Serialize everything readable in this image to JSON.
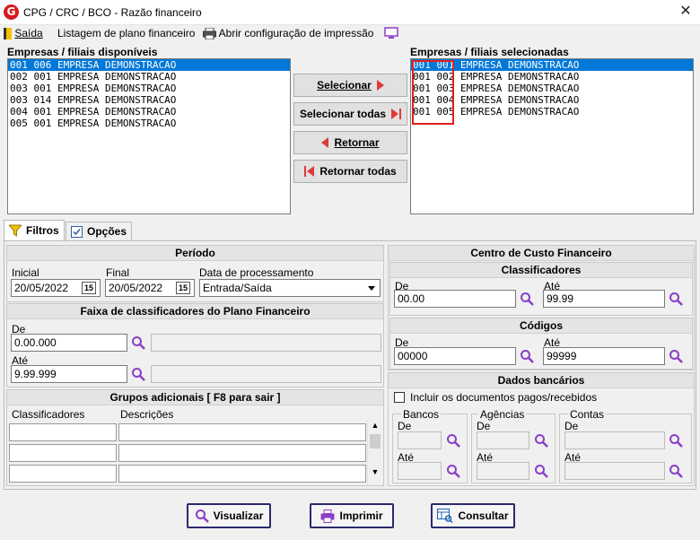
{
  "window": {
    "title": "CPG / CRC / BCO - Razão financeiro",
    "close_glyph": "✕"
  },
  "menu": {
    "exit_label": "Saída",
    "chart_list_label": "Listagem de plano financeiro",
    "print_config_label": "Abrir configuração de impressão"
  },
  "available": {
    "label": "Empresas / filiais disponíveis",
    "items": [
      "001 006 EMPRESA DEMONSTRACAO",
      "002 001 EMPRESA DEMONSTRACAO",
      "003 001 EMPRESA DEMONSTRACAO",
      "003 014 EMPRESA DEMONSTRACAO",
      "004 001 EMPRESA DEMONSTRACAO",
      "005 001 EMPRESA DEMONSTRACAO"
    ]
  },
  "selected": {
    "label": "Empresas / filiais selecionadas",
    "items": [
      "001 001 EMPRESA DEMONSTRACAO",
      "001 002 EMPRESA DEMONSTRACAO",
      "001 003 EMPRESA DEMONSTRACAO",
      "001 004 EMPRESA DEMONSTRACAO",
      "001 005 EMPRESA DEMONSTRACAO"
    ]
  },
  "transfer": {
    "select": "Selecionar",
    "select_all": "Selecionar todas",
    "return": "Retornar",
    "return_all": "Retornar todas"
  },
  "tabs": {
    "filters": "Filtros",
    "options": "Opções"
  },
  "periodo": {
    "title": "Período",
    "inicial_label": "Inicial",
    "inicial_value": "20/05/2022",
    "final_label": "Final",
    "final_value": "20/05/2022",
    "data_proc_label": "Data de processamento",
    "data_proc_value": "Entrada/Saída",
    "cal_glyph": "15"
  },
  "faixa": {
    "title": "Faixa de classificadores do Plano Financeiro",
    "de_label": "De",
    "de_value": "0.00.000",
    "ate_label": "Até",
    "ate_value": "9.99.999"
  },
  "grupos": {
    "title": "Grupos adicionais [ F8 para sair ]",
    "col_class": "Classificadores",
    "col_desc": "Descrições"
  },
  "centro": {
    "title": "Centro de Custo Financeiro",
    "class_title": "Classificadores",
    "class_de_label": "De",
    "class_de_value": "00.00",
    "class_ate_label": "Até",
    "class_ate_value": "99.99",
    "codigos_title": "Códigos",
    "cod_de_label": "De",
    "cod_de_value": "00000",
    "cod_ate_label": "Até",
    "cod_ate_value": "99999"
  },
  "dados": {
    "title": "Dados bancários",
    "include_label": "Incluir os documentos pagos/recebidos",
    "bancos": "Bancos",
    "agencias": "Agências",
    "contas": "Contas",
    "de_label": "De",
    "ate_label": "Até"
  },
  "footer": {
    "view": "Visualizar",
    "print": "Imprimir",
    "query": "Consultar"
  },
  "colors": {
    "accent": "#0078d7",
    "brand_red": "#d71920",
    "arrow_red": "#e03a3a",
    "search_purple": "#8a3fc7"
  }
}
